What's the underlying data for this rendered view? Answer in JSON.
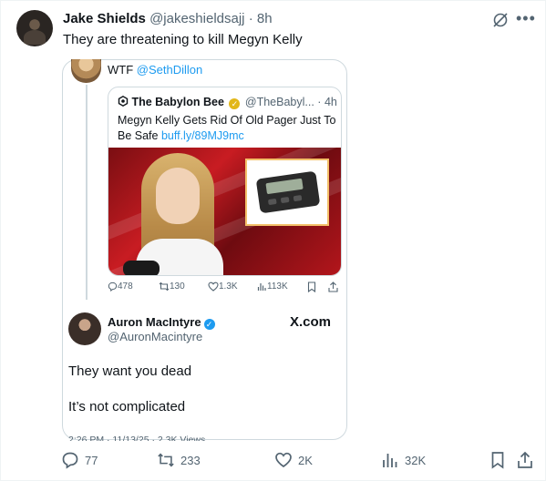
{
  "tweet": {
    "author_name": "Jake Shields",
    "author_handle": "@jakeshieldsajj",
    "separator": "·",
    "time": "8h",
    "text": "They are threatening to kill Megyn Kelly"
  },
  "screenshot": {
    "parent_text_prefix": "WTF ",
    "parent_mention": "@SethDillon",
    "quote": {
      "name": "The Babylon Bee",
      "handle": "@TheBabyl...",
      "separator": "·",
      "time": "4h",
      "text": "Megyn Kelly Gets Rid Of Old Pager Just To Be Safe ",
      "link": "buff.ly/89MJ9mc"
    },
    "stats": {
      "replies": "478",
      "reposts": "130",
      "likes": "1.3K",
      "views": "113K"
    },
    "reply": {
      "name": "Auron MacIntyre",
      "handle": "@AuronMacintyre",
      "watermark": "X.com",
      "line1": "They want you dead",
      "line2": "It’s not complicated",
      "footer": "2:26 PM · 11/13/25 · 2.3K Views"
    }
  },
  "actions": {
    "replies": "77",
    "reposts": "233",
    "likes": "2K",
    "views": "32K"
  },
  "colors": {
    "accent": "#1d9bf0",
    "text": "#0f1419",
    "muted": "#536471",
    "highlight": "#f6f25a",
    "gold_check": "#e2b719"
  }
}
